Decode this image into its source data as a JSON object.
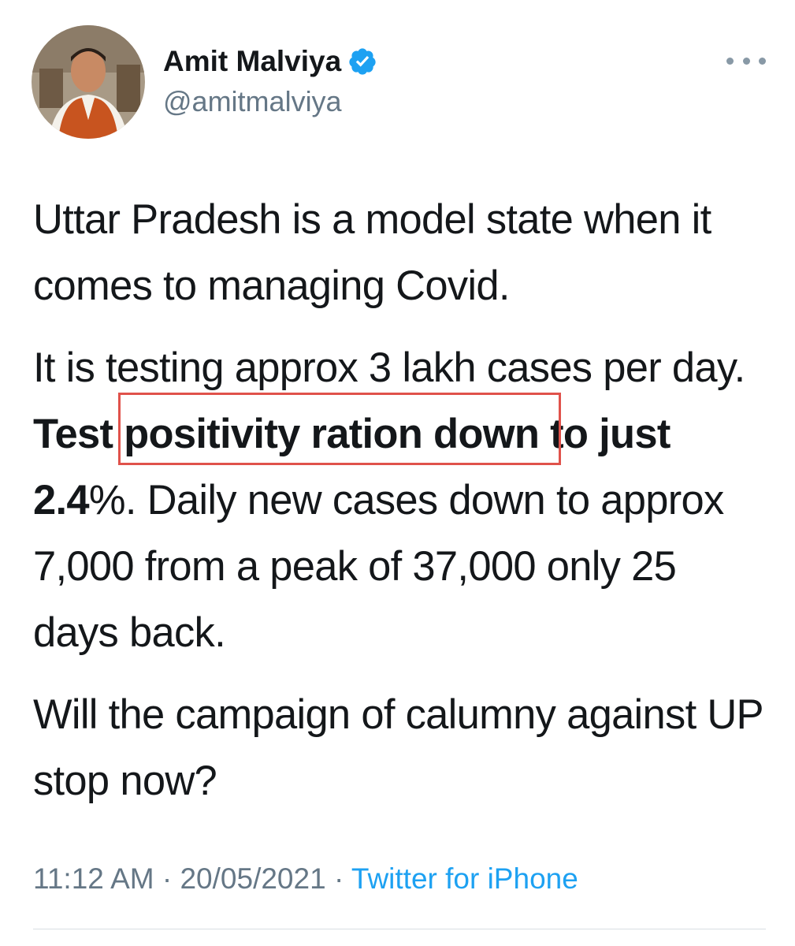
{
  "tweet": {
    "author": {
      "display_name": "Amit Malviya",
      "handle": "@amitmalviya",
      "verified": true,
      "avatar_icon": "profile-photo"
    },
    "body": {
      "p1": "Uttar Pradesh is a model state when it comes to managing Covid.",
      "p2_plain1": "It is testing approx 3 lakh cases per day. ",
      "p2_bold": "Test positivity ration down to just 2.4",
      "p2_plain2": "%. Daily new cases down to approx 7,000 from a peak of 37,000 only 25 days back.",
      "p3": "Will the campaign of calumny against UP stop now?"
    },
    "meta": {
      "time": "11:12 AM",
      "separator": " · ",
      "date": "20/05/2021",
      "source": "Twitter for iPhone"
    },
    "more_icon": "more-horizontal-icon",
    "verified_icon": "verified-badge-icon"
  },
  "colors": {
    "text": "#14171a",
    "muted": "#657786",
    "link": "#1da1f2",
    "highlight_border": "#e0524b"
  }
}
